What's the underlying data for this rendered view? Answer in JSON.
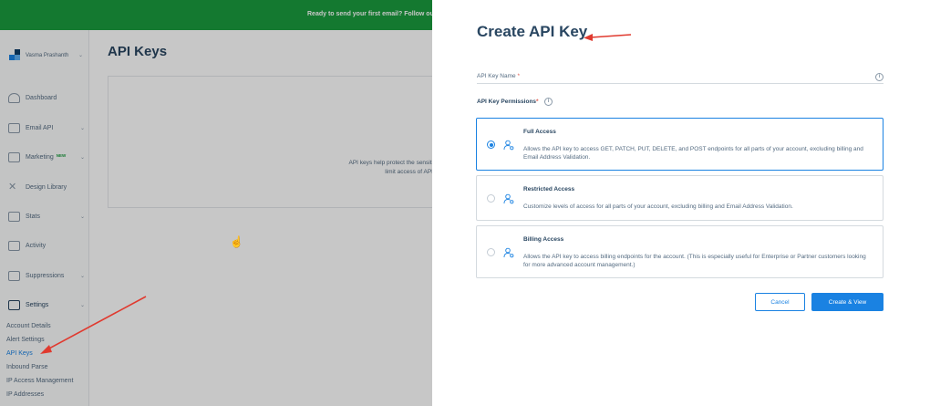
{
  "banner": {
    "text": "Ready to send your first email? Follow our"
  },
  "sidebar": {
    "account_name": "Vasma Prashanth",
    "items": [
      {
        "label": "Dashboard"
      },
      {
        "label": "Email API"
      },
      {
        "label": "Marketing",
        "badge": "NEW"
      },
      {
        "label": "Design Library"
      },
      {
        "label": "Stats"
      },
      {
        "label": "Activity"
      },
      {
        "label": "Suppressions"
      },
      {
        "label": "Settings"
      }
    ],
    "settings_sub": [
      {
        "label": "Account Details"
      },
      {
        "label": "Alert Settings"
      },
      {
        "label": "API Keys"
      },
      {
        "label": "Inbound Parse"
      },
      {
        "label": "IP Access Management"
      },
      {
        "label": "IP Addresses"
      }
    ]
  },
  "main": {
    "title": "API Keys",
    "card_text_1": "API keys help protect the sensiti",
    "card_text_2": "limit access of API"
  },
  "drawer": {
    "title": "Create API Key",
    "name_field": {
      "label": "API Key Name",
      "required_mark": "*",
      "value": ""
    },
    "permissions_label": "API Key Permissions",
    "required_mark": "*",
    "options": [
      {
        "title": "Full Access",
        "desc": "Allows the API key to access GET, PATCH, PUT, DELETE, and POST endpoints for all parts of your account, excluding billing and Email Address Validation.",
        "selected": true
      },
      {
        "title": "Restricted Access",
        "desc": "Customize levels of access for all parts of your account, excluding billing and Email Address Validation.",
        "selected": false
      },
      {
        "title": "Billing Access",
        "desc": "Allows the API key to access billing endpoints for the account. (This is especially useful for Enterprise or Partner customers looking for more advanced account management.)",
        "selected": false
      }
    ],
    "cancel_label": "Cancel",
    "create_label": "Create & View"
  },
  "colors": {
    "brand_green": "#1a9c3e",
    "accent_blue": "#1a82e2",
    "annotation_red": "#e03a2f",
    "heading": "#294661"
  },
  "icons": [
    "info-icon",
    "user-key-icon",
    "dashboard-icon",
    "mail-icon",
    "megaphone-icon",
    "design-icon",
    "stats-icon",
    "activity-icon",
    "suppressions-icon",
    "settings-icon"
  ]
}
